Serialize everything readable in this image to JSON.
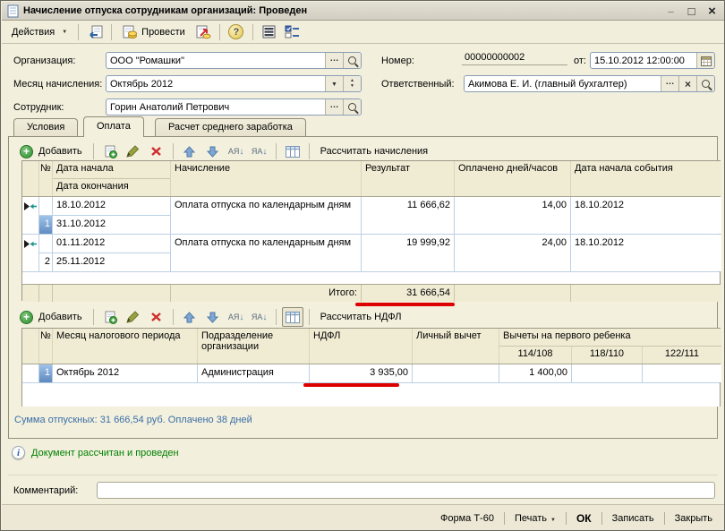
{
  "window": {
    "title": "Начисление отпуска сотрудникам организаций: Проведен"
  },
  "toolbar": {
    "actions_label": "Действия",
    "post_label": "Провести"
  },
  "form": {
    "org_label": "Организация:",
    "org_value": "ООО \"Ромашки\"",
    "month_label": "Месяц начисления:",
    "month_value": "Октябрь 2012",
    "employee_label": "Сотрудник:",
    "employee_value": "Горин Анатолий Петрович",
    "number_label": "Номер:",
    "number_value": "00000000002",
    "date_label": "от:",
    "date_value": "15.10.2012 12:00:00",
    "responsible_label": "Ответственный:",
    "responsible_value": "Акимова Е. И. (главный бухгалтер)"
  },
  "tabs": {
    "conditions": "Условия",
    "payment": "Оплата",
    "avg_calc": "Расчет среднего заработка"
  },
  "accruals": {
    "add_label": "Добавить",
    "calc_label": "Рассчитать начисления",
    "columns": {
      "num": "№",
      "date_start": "Дата начала",
      "date_end": "Дата окончания",
      "accrual": "Начисление",
      "result": "Результат",
      "paid": "Оплачено дней/часов",
      "event": "Дата начала события"
    },
    "rows": [
      {
        "num": "1",
        "date_start": "18.10.2012",
        "date_end": "31.10.2012",
        "accrual": "Оплата отпуска по календарным дням",
        "result": "11 666,62",
        "paid": "14,00",
        "event": "18.10.2012"
      },
      {
        "num": "2",
        "date_start": "01.11.2012",
        "date_end": "25.11.2012",
        "accrual": "Оплата отпуска по календарным дням",
        "result": "19 999,92",
        "paid": "24,00",
        "event": "18.10.2012"
      }
    ],
    "total_label": "Итого:",
    "total_value": "31 666,54"
  },
  "ndfl": {
    "add_label": "Добавить",
    "calc_label": "Рассчитать НДФЛ",
    "columns": {
      "num": "№",
      "month": "Месяц налогового периода",
      "division": "Подразделение организации",
      "ndfl": "НДФЛ",
      "personal": "Личный вычет",
      "child_group": "Вычеты на первого ребенка",
      "c114": "114/108",
      "c118": "118/110",
      "c122": "122/111"
    },
    "rows": [
      {
        "num": "1",
        "month": "Октябрь 2012",
        "division": "Администрация",
        "ndfl": "3 935,00",
        "personal": "",
        "c114": "1 400,00",
        "c118": "",
        "c122": ""
      }
    ]
  },
  "status": {
    "sum_text": "Сумма отпускных: 31 666,54 руб. Оплачено 38 дней",
    "info_text": "Документ рассчитан и проведен"
  },
  "comment": {
    "label": "Комментарий:",
    "value": ""
  },
  "footer": {
    "form_t60": "Форма Т-60",
    "print": "Печать",
    "ok": "ОК",
    "save": "Записать",
    "close": "Закрыть"
  },
  "colors": {
    "annotation_red": "#dd0000",
    "selected_row_blue": "#5e89bf",
    "status_blue": "#3a6ea5",
    "info_green": "#008000",
    "window_bg": "#f2efdd"
  }
}
